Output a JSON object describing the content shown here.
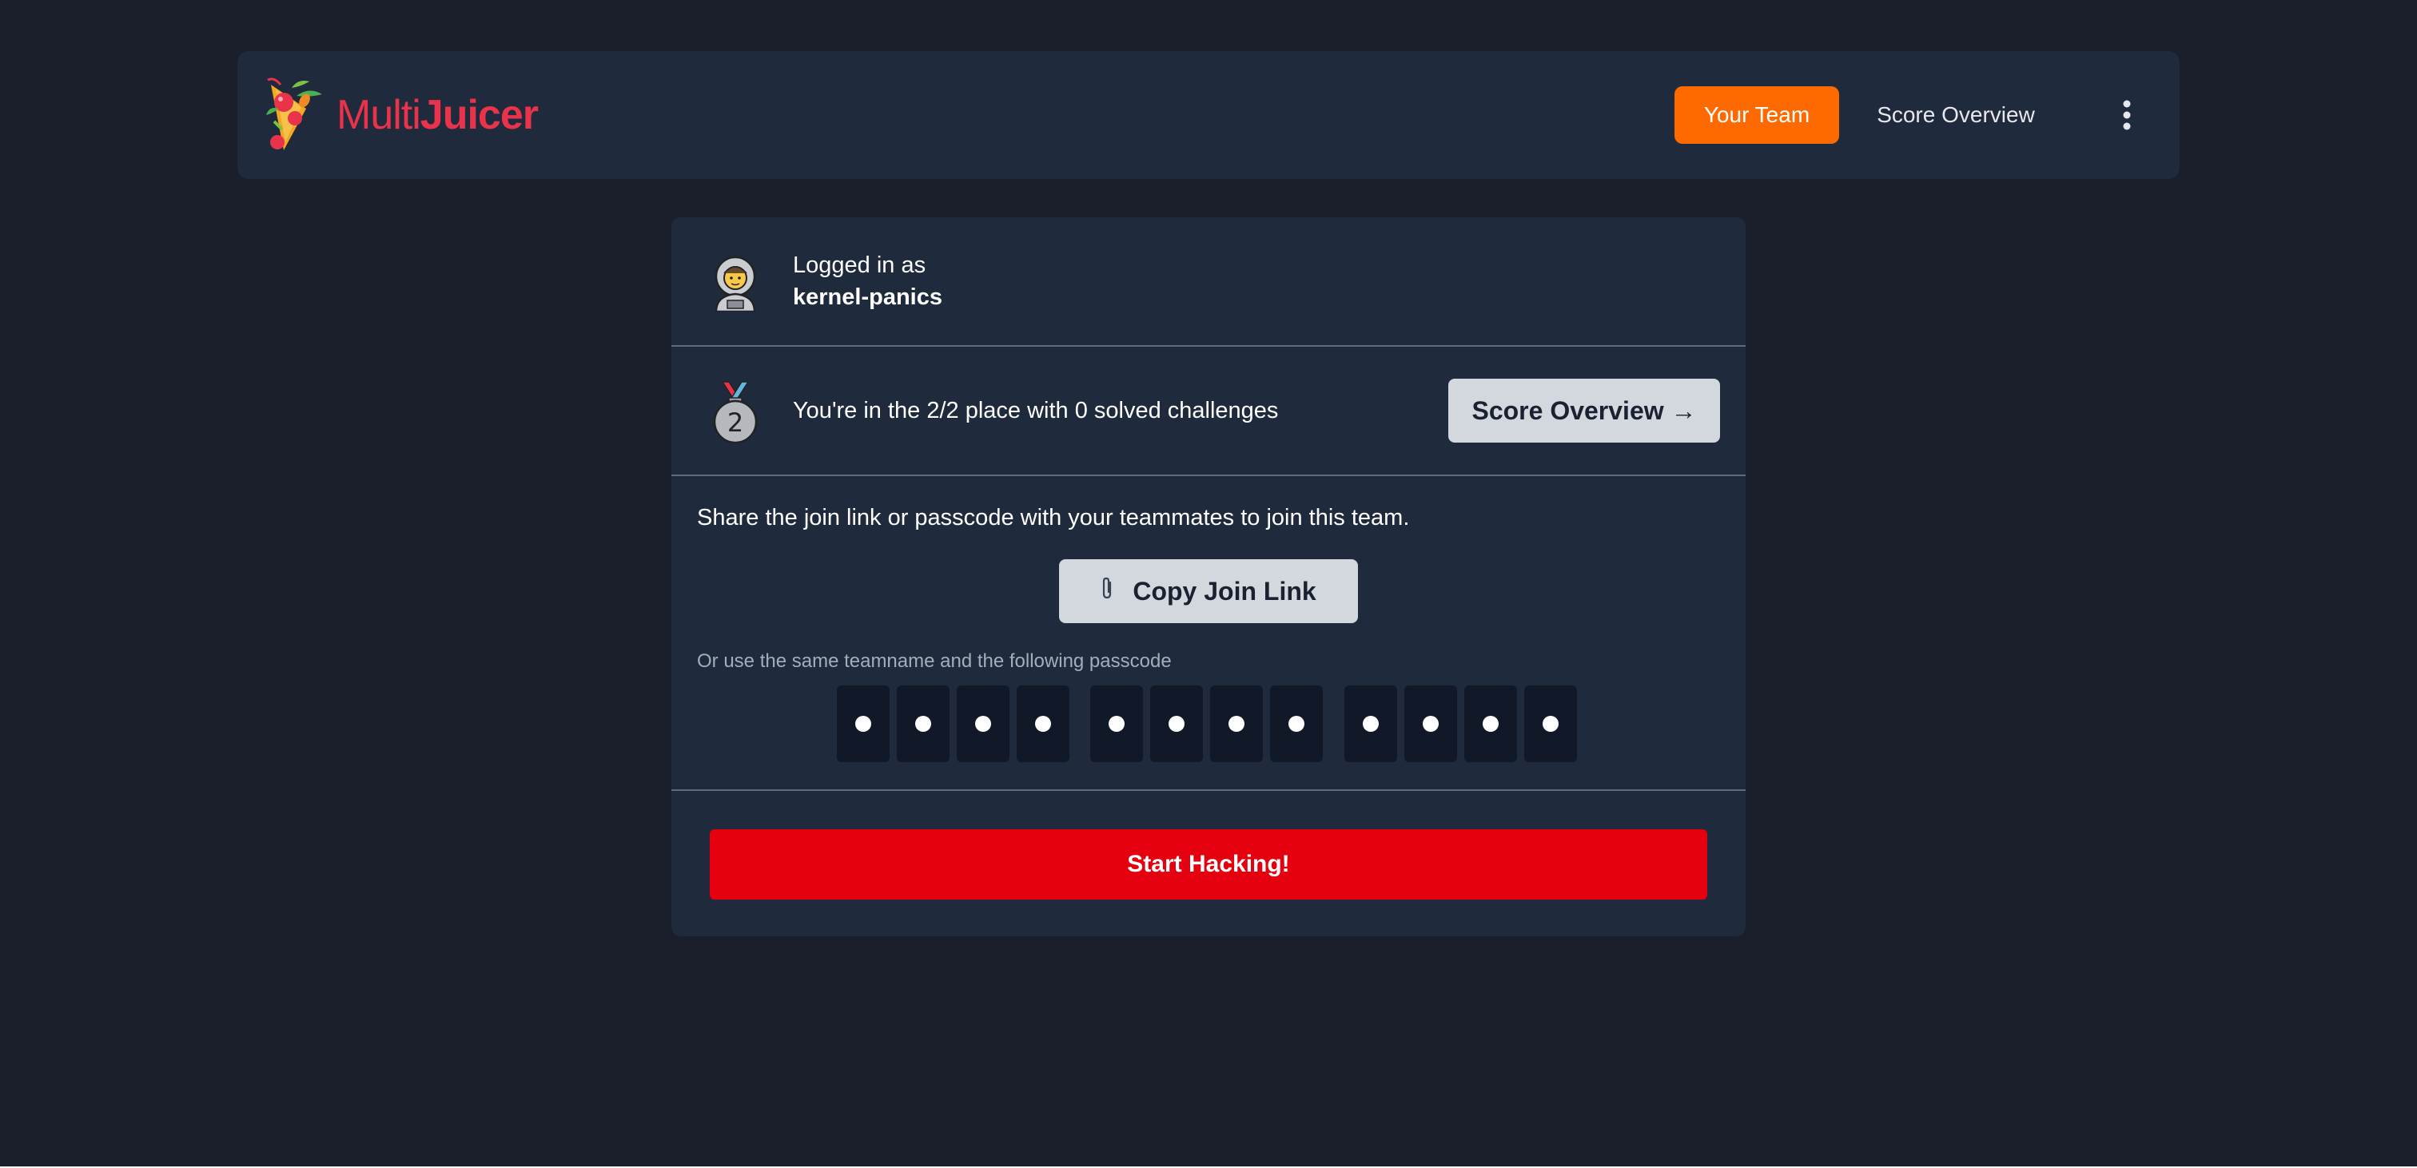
{
  "header": {
    "logo": {
      "text_light": "Multi",
      "text_bold": "Juicer",
      "icon": "fruit-cocktail-icon"
    },
    "nav": {
      "active_label": "Your Team",
      "link_label": "Score Overview",
      "menu_icon": "kebab-menu-icon"
    }
  },
  "card": {
    "login": {
      "label": "Logged in as",
      "team_name": "kernel-panics",
      "icon": "astronaut-avatar-icon"
    },
    "place": {
      "text": "You're in the 2/2 place with 0 solved challenges",
      "medal_number": "2",
      "icon": "second-place-medal-icon",
      "button_label": "Score Overview →"
    },
    "share": {
      "text": "Share the join link or passcode with your teammates to join this team.",
      "copy_button_label": "Copy Join Link",
      "copy_icon": "paperclip-icon",
      "passcode_hint": "Or use the same teamname and the following passcode",
      "passcode_groups": 3,
      "passcode_digits_per_group": 4
    },
    "start_button_label": "Start Hacking!"
  },
  "colors": {
    "background": "#1b1f2b",
    "panel": "#1f2a3c",
    "accent_orange": "#ff6a00",
    "start_red": "#e4000f",
    "logo_red": "#e8334a"
  }
}
